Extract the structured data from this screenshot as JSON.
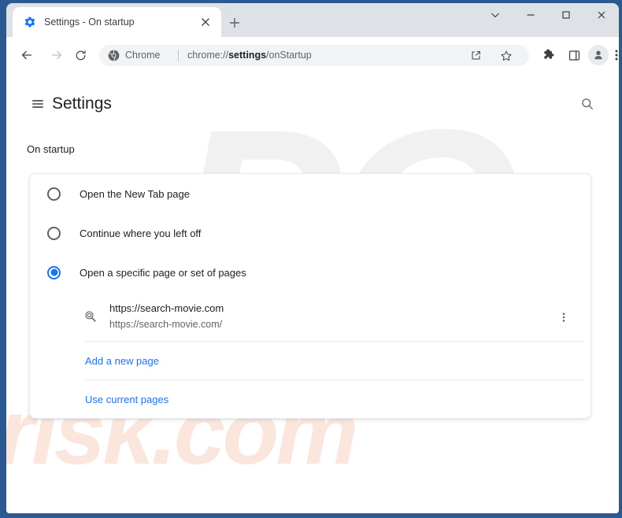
{
  "window": {
    "frame_color": "#2b5a92",
    "controls": {
      "tab_search_icon": "chevron-down-icon",
      "minimize_icon": "minimize-icon",
      "maximize_icon": "maximize-icon",
      "close_icon": "close-icon"
    }
  },
  "tabstrip": {
    "tab": {
      "favicon": "settings-gear-icon",
      "title": "Settings - On startup",
      "close_label": "Close tab"
    },
    "new_tab_label": "New tab"
  },
  "toolbar": {
    "back_label": "Back",
    "forward_label": "Forward",
    "reload_label": "Reload",
    "omnibox": {
      "chrome_icon": "chrome-logo-icon",
      "chrome_label": "Chrome",
      "url_prefix": "chrome://",
      "url_bold": "settings",
      "url_suffix": "/onStartup",
      "share_icon": "share-icon",
      "bookmark_icon": "star-icon"
    },
    "extensions_icon": "puzzle-piece-icon",
    "sidepanel_icon": "side-panel-icon",
    "profile_icon": "person-avatar-icon",
    "menu_icon": "three-dot-menu-icon"
  },
  "settings_page": {
    "menu_label": "Main menu",
    "title": "Settings",
    "search_label": "Search settings",
    "section_label": "On startup",
    "accent_color": "#1a73e8",
    "options": [
      {
        "label": "Open the New Tab page",
        "selected": false
      },
      {
        "label": "Continue where you left off",
        "selected": false
      },
      {
        "label": "Open a specific page or set of pages",
        "selected": true
      }
    ],
    "startup_pages": [
      {
        "favicon": "magnifier-favicon",
        "title": "https://search-movie.com",
        "url": "https://search-movie.com/",
        "more_label": "More actions"
      }
    ],
    "links": [
      {
        "label": "Add a new page"
      },
      {
        "label": "Use current pages"
      }
    ]
  },
  "watermark": {
    "primary": "PC",
    "secondary": "risk.com"
  }
}
